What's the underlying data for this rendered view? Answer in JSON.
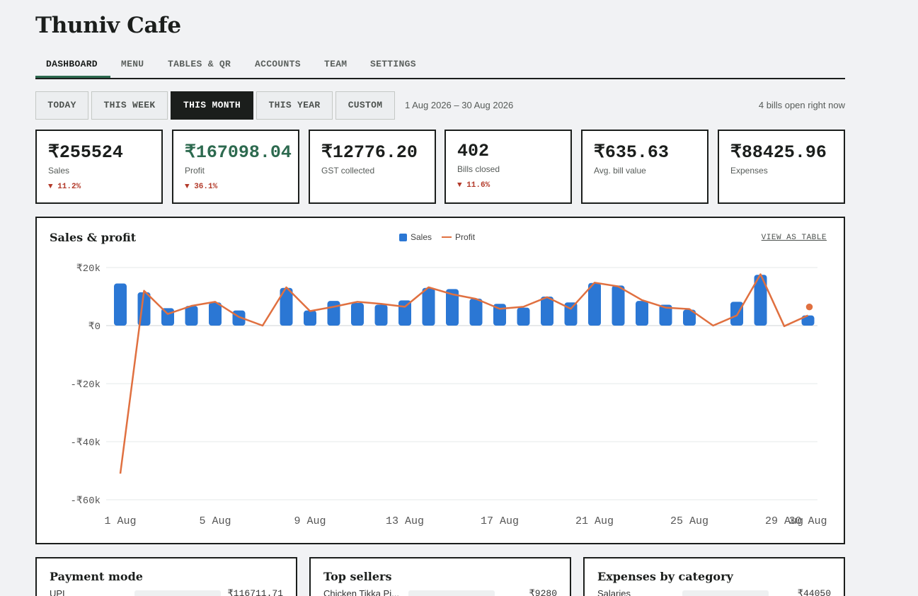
{
  "app": {
    "title": "Thuniv Cafe"
  },
  "nav": {
    "tabs": [
      "DASHBOARD",
      "MENU",
      "TABLES & QR",
      "ACCOUNTS",
      "TEAM",
      "SETTINGS"
    ],
    "active": "DASHBOARD"
  },
  "range": {
    "buttons": [
      "TODAY",
      "THIS WEEK",
      "THIS MONTH",
      "THIS YEAR",
      "CUSTOM"
    ],
    "active": "THIS MONTH",
    "date_range": "1 Aug 2026 – 30 Aug 2026",
    "open_bills": "4 bills open right now"
  },
  "kpis": [
    {
      "value": "₹255524",
      "label": "Sales",
      "delta": "▼ 11.2%"
    },
    {
      "value": "₹167098.04",
      "label": "Profit",
      "delta": "▼ 36.1%"
    },
    {
      "value": "₹12776.20",
      "label": "GST collected",
      "delta": ""
    },
    {
      "value": "402",
      "label": "Bills closed",
      "delta": "▼ 11.6%"
    },
    {
      "value": "₹635.63",
      "label": "Avg. bill value",
      "delta": ""
    },
    {
      "value": "₹88425.96",
      "label": "Expenses",
      "delta": ""
    }
  ],
  "colors": {
    "sales": "#2b77d4",
    "profit": "#e07040",
    "profit_kpi": "#2d6a4f",
    "delta_down": "#b33a2a"
  },
  "chart": {
    "title": "Sales & profit",
    "view_table": "VIEW AS TABLE"
  },
  "chart_data": {
    "type": "bar",
    "title": "Sales & profit",
    "x_ticks": [
      "1 Aug",
      "5 Aug",
      "9 Aug",
      "13 Aug",
      "17 Aug",
      "21 Aug",
      "25 Aug",
      "29 Aug",
      "30 Aug"
    ],
    "y_ticks": [
      "₹20k",
      "₹0",
      "-₹20k",
      "-₹40k",
      "-₹60k"
    ],
    "ylim": [
      -60000,
      20000
    ],
    "legend_position": "top-center",
    "grid": true,
    "categories": [
      "1 Aug",
      "2 Aug",
      "3 Aug",
      "4 Aug",
      "5 Aug",
      "6 Aug",
      "7 Aug",
      "8 Aug",
      "9 Aug",
      "10 Aug",
      "11 Aug",
      "12 Aug",
      "13 Aug",
      "14 Aug",
      "15 Aug",
      "16 Aug",
      "17 Aug",
      "18 Aug",
      "19 Aug",
      "20 Aug",
      "21 Aug",
      "22 Aug",
      "23 Aug",
      "24 Aug",
      "25 Aug",
      "26 Aug",
      "27 Aug",
      "28 Aug",
      "29 Aug",
      "30 Aug"
    ],
    "series": [
      {
        "name": "Sales",
        "type": "bar",
        "values": [
          14500,
          11500,
          6000,
          6800,
          8000,
          5200,
          0,
          13000,
          5200,
          8500,
          7800,
          7200,
          8700,
          13000,
          12600,
          9300,
          7500,
          6200,
          10000,
          8000,
          14700,
          13800,
          8500,
          7200,
          5500,
          0,
          8200,
          17500,
          0,
          3500
        ]
      },
      {
        "name": "Profit",
        "type": "line",
        "values": [
          -51000,
          12000,
          4000,
          6800,
          8200,
          3000,
          0,
          13200,
          5000,
          6500,
          8200,
          7500,
          6500,
          13200,
          10800,
          9200,
          5800,
          6500,
          9800,
          5800,
          14800,
          13500,
          8800,
          6200,
          5700,
          0,
          3500,
          17700,
          -200,
          3500
        ]
      }
    ]
  },
  "bottom_cards": [
    {
      "title": "Payment mode",
      "first_label": "UPI",
      "first_value": "₹116711.71"
    },
    {
      "title": "Top sellers",
      "first_label": "Chicken Tikka Pi...",
      "first_value": "₹9280"
    },
    {
      "title": "Expenses by category",
      "first_label": "Salaries",
      "first_value": "₹44050"
    }
  ]
}
